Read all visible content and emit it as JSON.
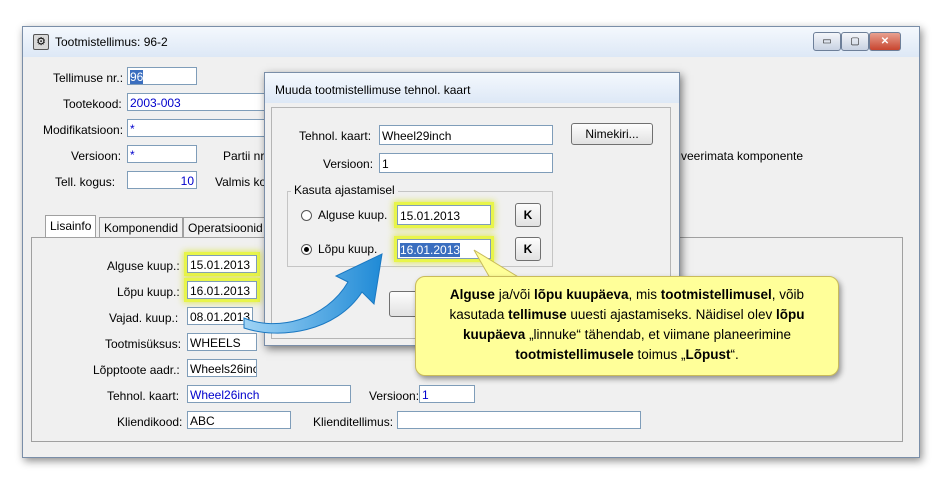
{
  "main": {
    "title": "Tootmistellimus: 96-2",
    "controls": {
      "minimize": "▭",
      "maximize": "▢",
      "close": "✕"
    },
    "fields": {
      "order_no_label": "Tellimuse nr.:",
      "order_no_value": "96",
      "product_code_label": "Tootekood:",
      "product_code_value": "2003-003",
      "modification_label": "Modifikatsioon:",
      "modification_value": "*",
      "version_label": "Versioon:",
      "version_value": "*",
      "batch_label": "Partii nr.",
      "order_qty_label": "Tell. kogus:",
      "order_qty_value": "10",
      "ready_label": "Valmis ko",
      "unreserved_text": "veerimata komponente"
    },
    "tabs": [
      "Lisainfo",
      "Komponendid",
      "Operatsioonid"
    ],
    "lisainfo": {
      "start_date_label": "Alguse kuup.:",
      "start_date_value": "15.01.2013",
      "end_date_label": "Lõpu kuup.:",
      "end_date_value": "16.01.2013",
      "needed_date_label": "Vajad. kuup.:",
      "needed_date_value": "08.01.2013",
      "production_unit_label": "Tootmisüksus:",
      "production_unit_value": "WHEELS",
      "final_product_addr_label": "Lõpptoote aadr.:",
      "final_product_addr_value": "Wheels26inc",
      "routing_label": "Tehnol. kaart:",
      "routing_value": "Wheel26inch",
      "routing_version_label": "Versioon:",
      "routing_version_value": "1",
      "customer_code_label": "Kliendikood:",
      "customer_code_value": "ABC",
      "customer_order_label": "Klienditellimus:",
      "customer_order_value": ""
    }
  },
  "dialog": {
    "title": "Muuda tootmistellimuse tehnol. kaart",
    "routing_label": "Tehnol. kaart:",
    "routing_value": "Wheel29inch",
    "list_button": "Nimekiri...",
    "version_label": "Versioon:",
    "version_value": "1",
    "group_label": "Kasuta ajastamisel",
    "start_radio_label": "Alguse kuup.",
    "start_date_value": "15.01.2013",
    "end_radio_label": "Lõpu kuup.",
    "end_date_value": "16.01.2013",
    "calendar_button": "K",
    "selected_radio": "end"
  },
  "callout": {
    "p1": "Alguse",
    "p2": " ja/või ",
    "p3": "lõpu kuupäeva",
    "p4": ", mis ",
    "p5": "tootmistellimusel",
    "p6": ", võib kasutada ",
    "p7": "tellimuse",
    "p8": " uuesti ajastamiseks. Näidisel olev ",
    "p9": "lõpu kuupäeva",
    "p10": " „linnuke“ tähendab, et viimane planeerimine ",
    "p11": "tootmistellimusele",
    "p12": " toimus „",
    "p13": "Lõpust",
    "p14": "“."
  },
  "colors": {
    "highlight": "#e8f54a",
    "callout_bg": "#ffff99",
    "arrow": "#3aa0e0",
    "selection": "#3a6ebf"
  }
}
